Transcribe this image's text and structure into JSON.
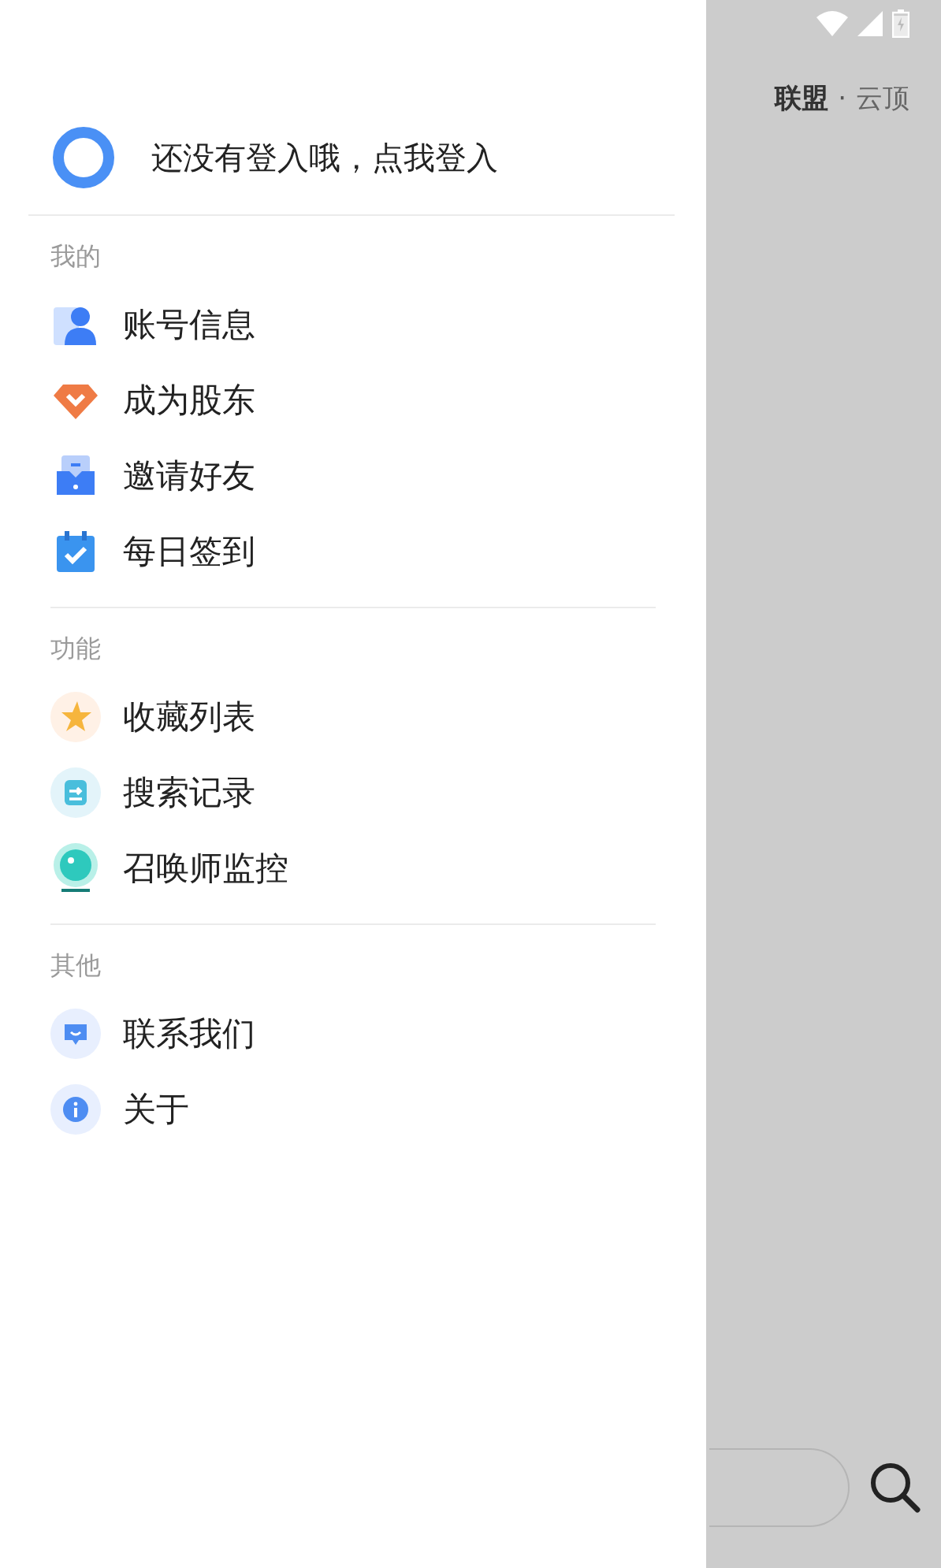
{
  "background_app": {
    "tabs": [
      {
        "label": "联盟",
        "selected": true
      },
      {
        "label": "云顶",
        "selected": false
      }
    ],
    "tab_separator": "·"
  },
  "drawer": {
    "login_prompt": "还没有登入哦，点我登入",
    "sections": [
      {
        "title": "我的",
        "items": [
          "账号信息",
          "成为股东",
          "邀请好友",
          "每日签到"
        ]
      },
      {
        "title": "功能",
        "items": [
          "收藏列表",
          "搜索记录",
          "召唤师监控"
        ]
      },
      {
        "title": "其他",
        "items": [
          "联系我们",
          "关于"
        ]
      }
    ]
  }
}
